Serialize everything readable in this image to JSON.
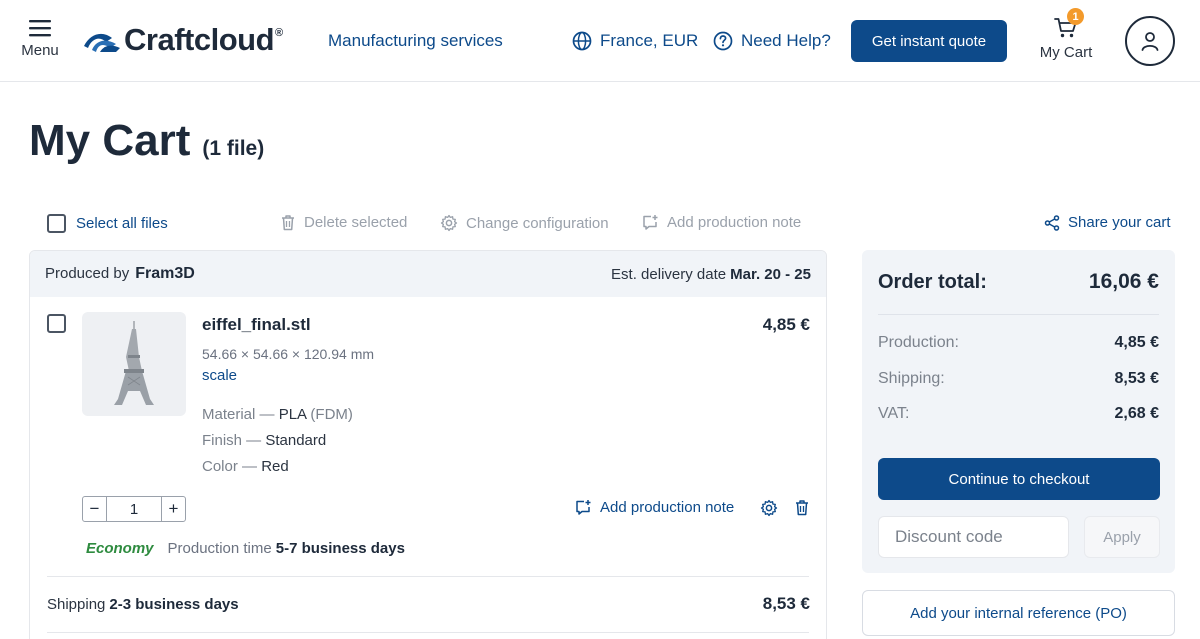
{
  "header": {
    "menu_label": "Menu",
    "brand": "Craftcloud",
    "brand_mark": "®",
    "services_link": "Manufacturing services",
    "region": "France, EUR",
    "help": "Need Help?",
    "quote_button": "Get instant quote",
    "cart_label": "My Cart",
    "cart_count": "1"
  },
  "page": {
    "title": "My Cart",
    "file_count": "(1 file)"
  },
  "toolbar": {
    "select_all": "Select all files",
    "delete_selected": "Delete selected",
    "change_configuration": "Change configuration",
    "add_production_note": "Add production note",
    "share_cart": "Share your cart"
  },
  "vendor": {
    "produced_by_label": "Produced by",
    "name": "Fram3D",
    "delivery_label": "Est. delivery date",
    "delivery_date": "Mar. 20 - 25"
  },
  "item": {
    "file_name": "eiffel_final.stl",
    "dimensions": "54.66 × 54.66 × 120.94 mm",
    "scale_link": "scale",
    "price": "4,85 €",
    "material_label": "Material —",
    "material": "PLA",
    "material_process": "(FDM)",
    "finish_label": "Finish —",
    "finish": "Standard",
    "color_label": "Color —",
    "color": "Red",
    "quantity": "1",
    "minus": "−",
    "plus": "+",
    "add_note": "Add production note",
    "speed": "Economy",
    "production_time_label": "Production time",
    "production_time": "5-7 business days"
  },
  "shipping": {
    "label": "Shipping",
    "time": "2-3 business days",
    "price": "8,53 €"
  },
  "summary": {
    "title": "Order total:",
    "total": "16,06 €",
    "production_label": "Production:",
    "production": "4,85 €",
    "shipping_label": "Shipping:",
    "shipping": "8,53 €",
    "vat_label": "VAT:",
    "vat": "2,68 €",
    "checkout_button": "Continue to checkout",
    "discount_placeholder": "Discount code",
    "apply_button": "Apply",
    "po_button": "Add your internal reference (PO)"
  },
  "colors": {
    "primary": "#0d4a8a",
    "badge": "#f39a2b",
    "economy": "#2e8b3f",
    "panel": "#f1f4f8"
  }
}
